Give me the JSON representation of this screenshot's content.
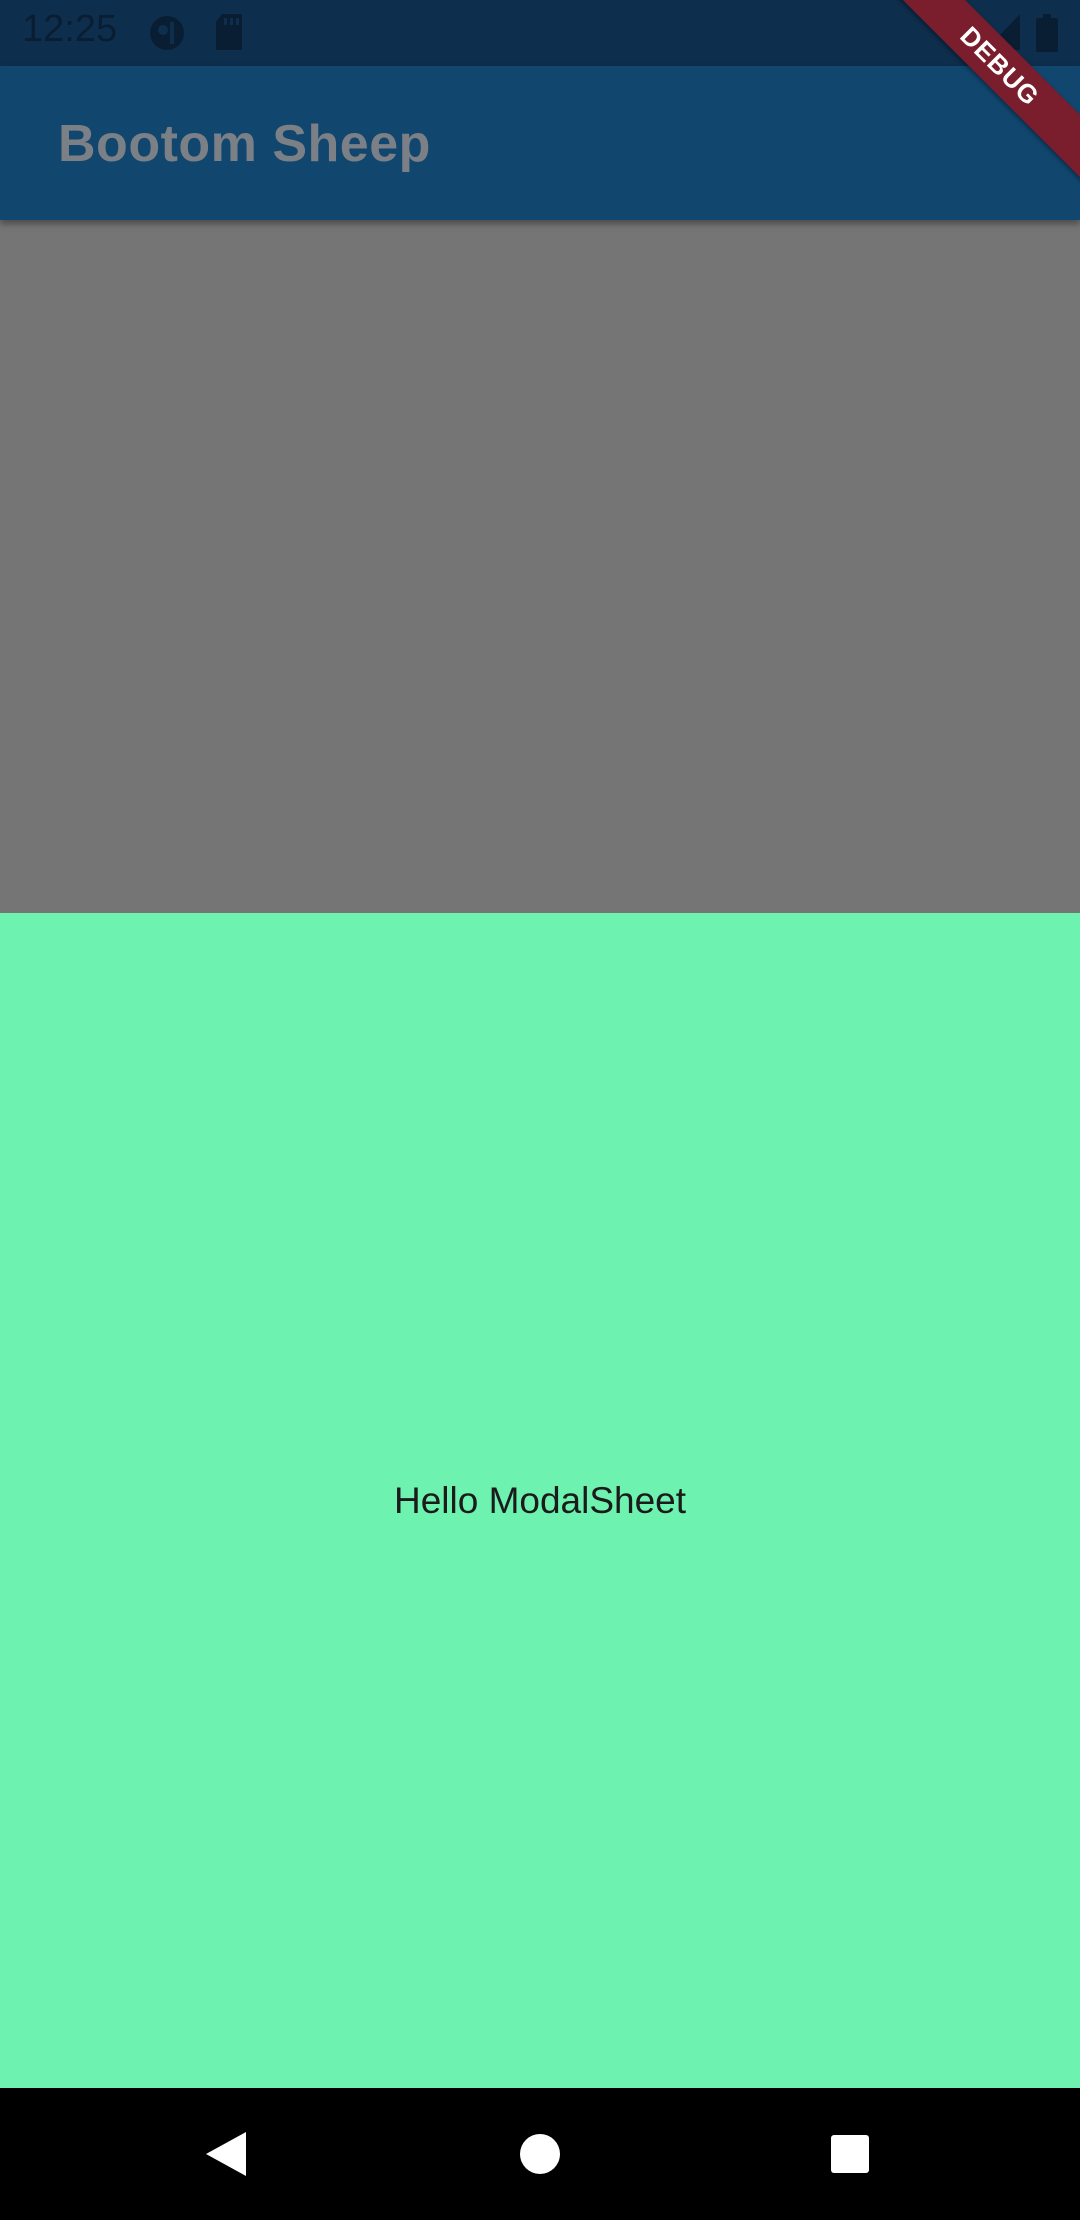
{
  "status_bar": {
    "time": "12:25",
    "icons": [
      "app-notification-icon",
      "sd-card-icon",
      "wifi-icon",
      "signal-icon",
      "battery-icon"
    ]
  },
  "app_bar": {
    "title": "Bootom Sheep"
  },
  "bottom_sheet": {
    "text": "Hello ModalSheet",
    "background_color": "#6ef2b0"
  },
  "debug_banner": {
    "label": "DEBUG"
  },
  "nav_bar": {
    "buttons": [
      "back-icon",
      "home-icon",
      "recents-icon"
    ]
  },
  "colors": {
    "status_bar": "#0d2e4d",
    "app_bar": "#11466f",
    "scrim": "#757575",
    "sheet": "#6ef2b0",
    "debug": "#7a1e2e"
  }
}
